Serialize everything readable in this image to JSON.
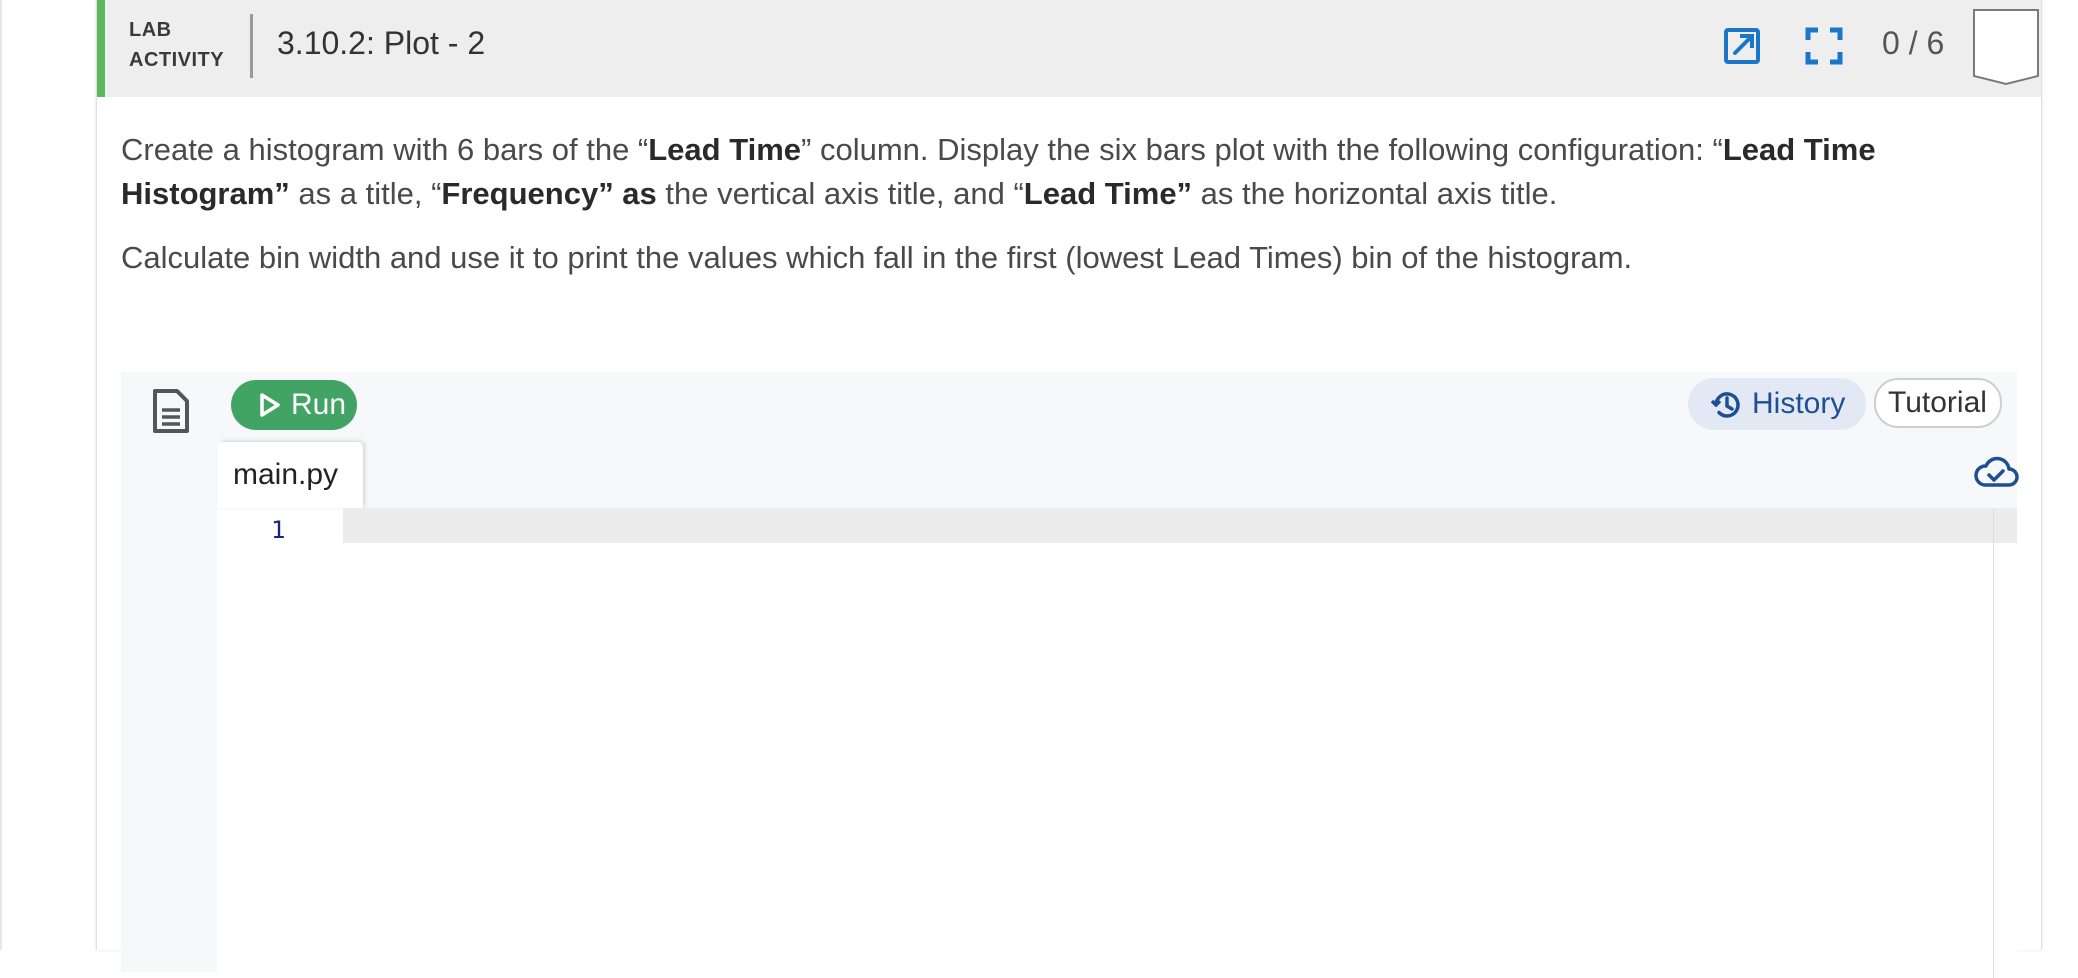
{
  "header": {
    "lab_label_line1": "LAB",
    "lab_label_line2": "ACTIVITY",
    "title": "3.10.2: Plot - 2",
    "score": "0 / 6",
    "icons": [
      "open-external-icon",
      "fullscreen-icon",
      "completion-badge-icon"
    ]
  },
  "description": {
    "p1": [
      {
        "text": "Create a histogram with 6 bars of the “",
        "bold": false
      },
      {
        "text": "Lead Time",
        "bold": true
      },
      {
        "text": "” column. Display the six bars plot with the following configuration: “",
        "bold": false
      },
      {
        "text": "Lead Time Histogram”",
        "bold": true
      },
      {
        "text": " as a title, “",
        "bold": false
      },
      {
        "text": "Frequency” as",
        "bold": true
      },
      {
        "text": " the vertical axis title, and “",
        "bold": false
      },
      {
        "text": "Lead Time”",
        "bold": true
      },
      {
        "text": " as the horizontal axis title.",
        "bold": false
      }
    ],
    "p2": "Calculate bin width and use it to print the values which fall in the first (lowest Lead Times) bin of the histogram."
  },
  "ide": {
    "run_label": "Run",
    "history_label": "History",
    "tutorial_label": "Tutorial",
    "file_name": "main.py",
    "line_numbers": [
      "1"
    ],
    "code_lines": [
      ""
    ],
    "colors": {
      "run": "#41a465",
      "history_bg": "#e3e9f4",
      "history_text": "#1e4f93",
      "accent": "#5cb85c",
      "icon_blue": "#1b75c9"
    }
  }
}
